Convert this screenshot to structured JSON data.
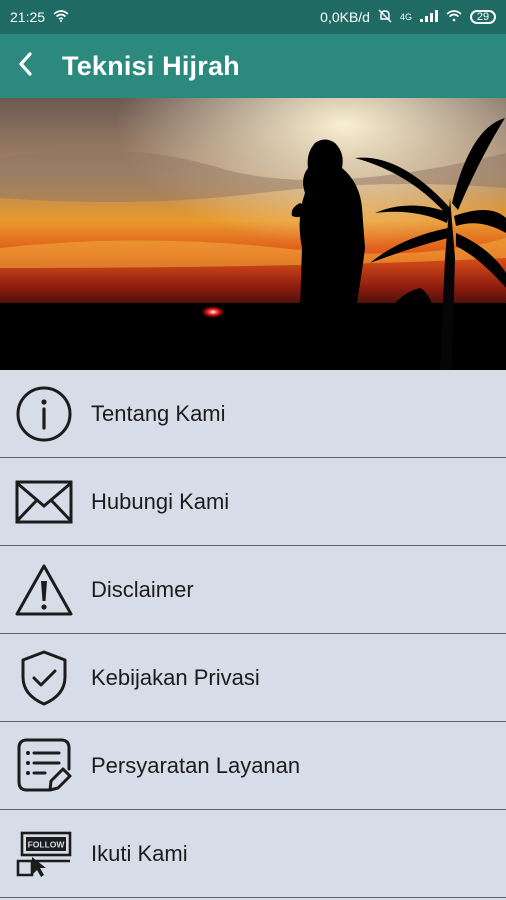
{
  "status_bar": {
    "time": "21:25",
    "network_speed": "0,0KB/d",
    "network_type": "4G",
    "battery": "29",
    "icons": [
      "wifi-icon",
      "bell-off-icon",
      "signal-icon",
      "battery-icon"
    ]
  },
  "app_bar": {
    "title": "Teknisi Hijrah",
    "back_icon": "chevron-left-icon"
  },
  "banner": {
    "description_icon": "sunset-silhouette-image"
  },
  "menu": {
    "items": [
      {
        "label": "Tentang Kami",
        "icon": "info-icon"
      },
      {
        "label": "Hubungi Kami",
        "icon": "envelope-icon"
      },
      {
        "label": "Disclaimer",
        "icon": "warning-icon"
      },
      {
        "label": "Kebijakan Privasi",
        "icon": "shield-check-icon"
      },
      {
        "label": "Persyaratan Layanan",
        "icon": "document-pen-icon"
      },
      {
        "label": "Ikuti Kami",
        "icon": "follow-icon"
      }
    ]
  },
  "colors": {
    "status_bar": "#1f6b63",
    "app_bar": "#2b8a7d",
    "menu_background": "#d6dde8",
    "divider": "#5f6670"
  }
}
